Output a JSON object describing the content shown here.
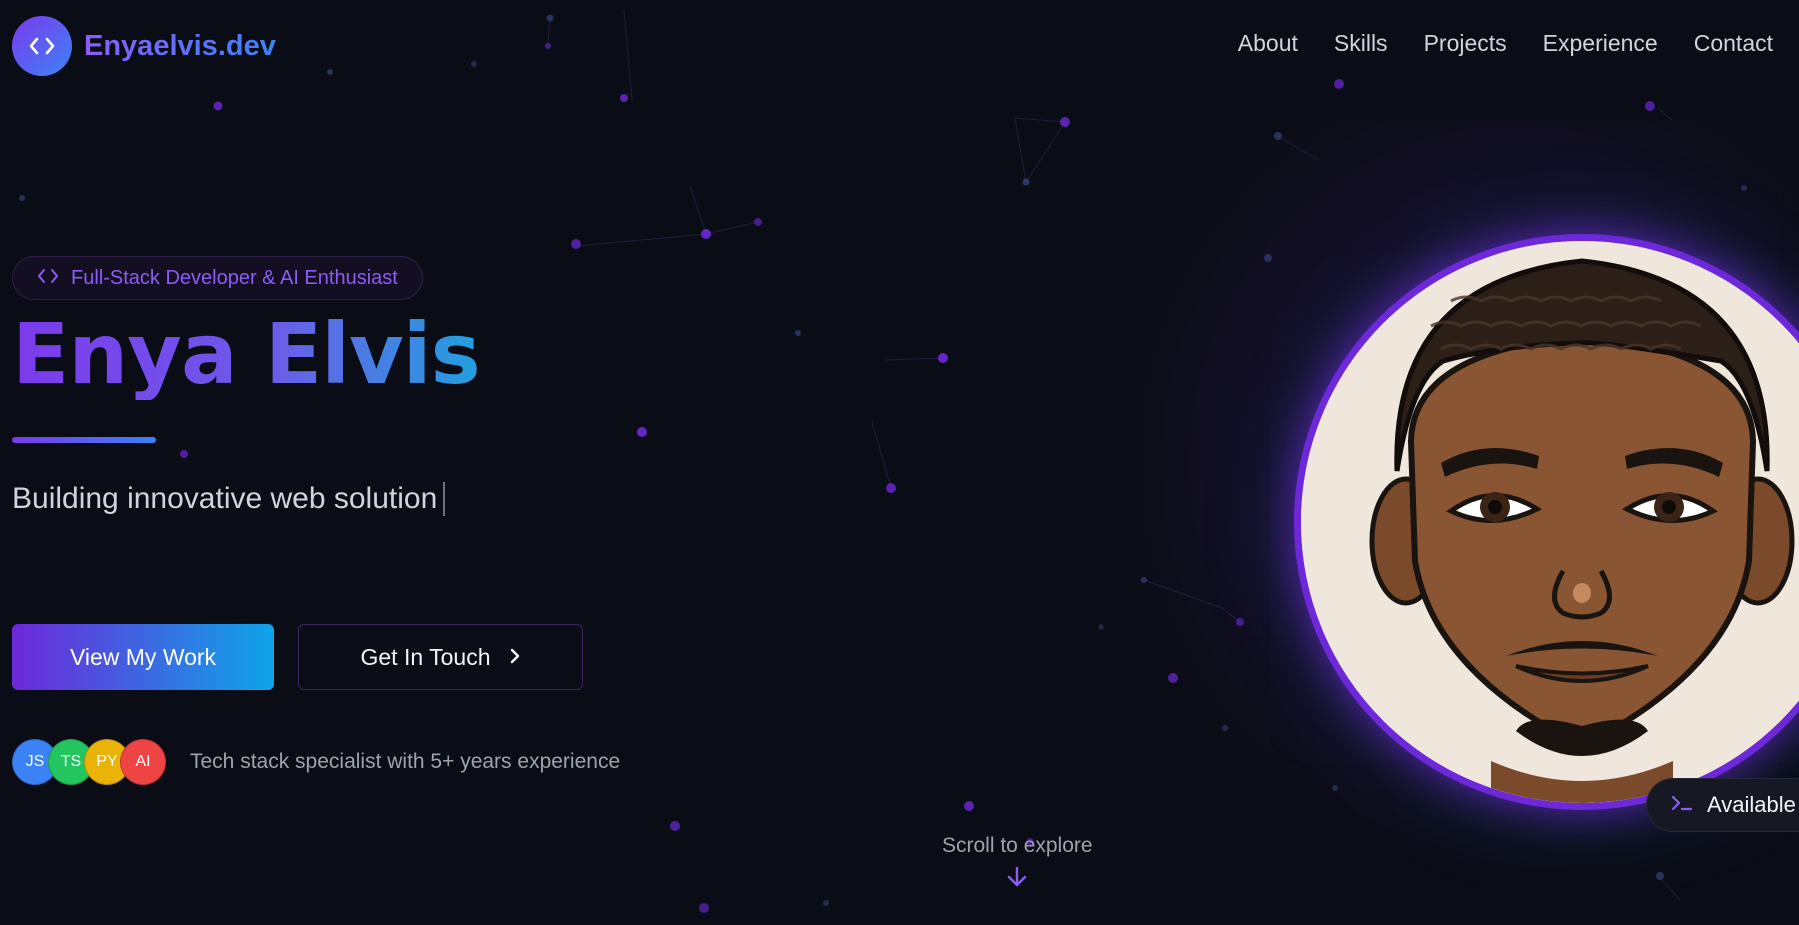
{
  "brand": {
    "logo_text": "Enyaelvis.dev"
  },
  "nav": {
    "items": [
      {
        "label": "About"
      },
      {
        "label": "Skills"
      },
      {
        "label": "Projects"
      },
      {
        "label": "Experience"
      },
      {
        "label": "Contact"
      }
    ]
  },
  "hero": {
    "role_badge": "Full-Stack Developer & AI Enthusiast",
    "name": "Enya Elvis",
    "tagline": "Building innovative web solution",
    "primary_button": "View My Work",
    "secondary_button": "Get In Touch",
    "tech_chips": [
      {
        "label": "JS",
        "color": "#3b82f6"
      },
      {
        "label": "TS",
        "color": "#22c55e"
      },
      {
        "label": "PY",
        "color": "#eab308"
      },
      {
        "label": "AI",
        "color": "#ef4444"
      }
    ],
    "stack_text": "Tech stack specialist with 5+ years experience",
    "scroll_hint": "Scroll to explore"
  },
  "avatar": {
    "status": "Available"
  },
  "colors": {
    "background": "#0b0d16",
    "accent_purple": "#7c3aed",
    "accent_blue": "#3b82f6"
  }
}
